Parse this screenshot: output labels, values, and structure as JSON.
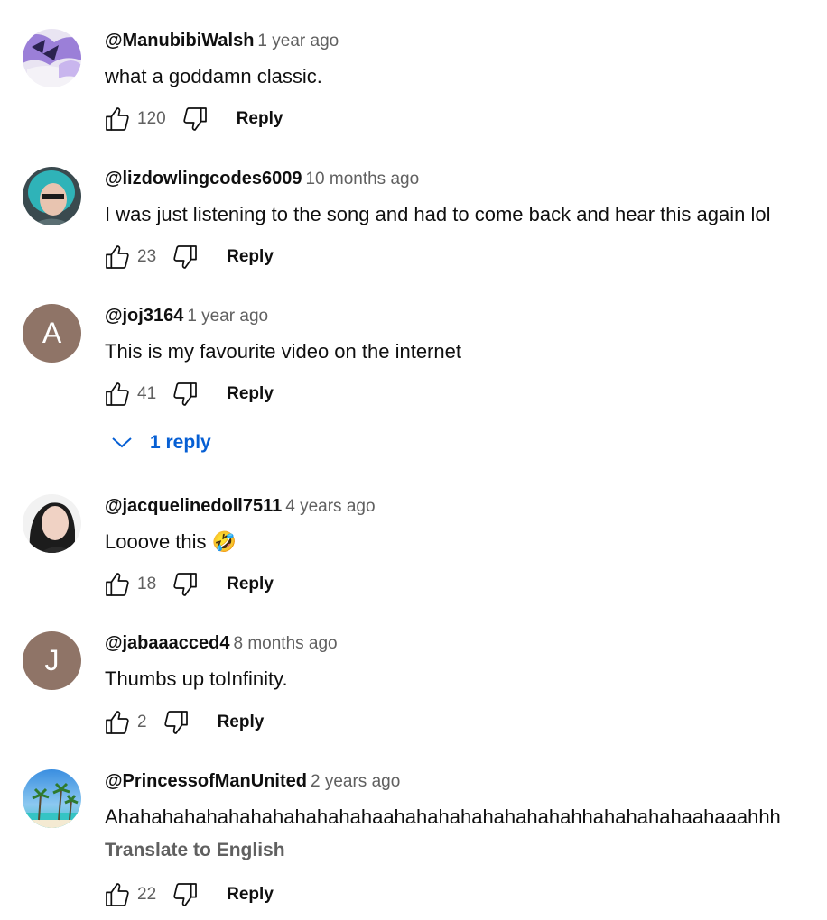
{
  "comments": [
    {
      "author": "@ManubibiWalsh",
      "time": "1 year ago",
      "text": "what a goddamn classic.",
      "likes": "120",
      "reply_label": "Reply",
      "avatar": "purple-art-avatar"
    },
    {
      "author": "@lizdowlingcodes6009",
      "time": "10 months ago",
      "text": "I was just listening to the song and had to come back and hear this again lol",
      "likes": "23",
      "reply_label": "Reply",
      "avatar": "photo-avatar"
    },
    {
      "author": "@joj3164",
      "time": "1 year ago",
      "text": "This is my favourite video on the internet",
      "likes": "41",
      "reply_label": "Reply",
      "avatar_letter": "A",
      "replies_label": "1 reply"
    },
    {
      "author": "@jacquelinedoll7511",
      "time": "4 years ago",
      "text": "Looove this",
      "emoji": "🤣",
      "likes": "18",
      "reply_label": "Reply",
      "avatar": "photo-avatar"
    },
    {
      "author": "@jabaaacced4",
      "time": "8 months ago",
      "text": "Thumbs up toInfinity.",
      "likes": "2",
      "reply_label": "Reply",
      "avatar_letter": "J"
    },
    {
      "author": "@PrincessofManUnited",
      "time": "2 years ago",
      "text": "Ahahahahahahahahahahahahaahahahahahahahahahhahahahahaahaaahhh",
      "translate_label": "Translate to English",
      "likes": "22",
      "reply_label": "Reply",
      "avatar": "palm-beach-avatar"
    }
  ],
  "colors": {
    "link": "#065fd4",
    "muted": "#606060",
    "letter_avatar": "#8f7467"
  }
}
